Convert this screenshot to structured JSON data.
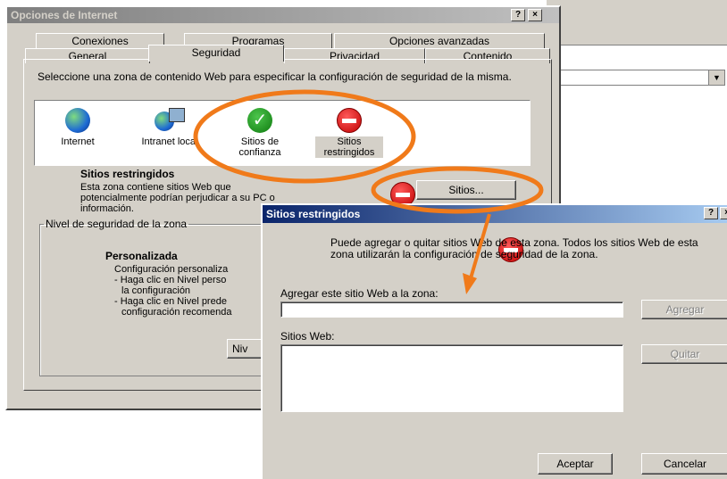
{
  "background_app": {
    "dropdown_arrow": "▼"
  },
  "main_dialog": {
    "title": "Opciones de Internet",
    "help_button": "?",
    "close_button": "×",
    "tabs_back_row": [
      "Conexiones",
      "Programas",
      "Opciones avanzadas"
    ],
    "tabs_front_row": [
      "General",
      "Seguridad",
      "Privacidad",
      "Contenido"
    ],
    "selected_tab": "Seguridad",
    "instruction": "Seleccione una zona de contenido Web para especificar la configuración de seguridad de la misma.",
    "zones": [
      {
        "label": "Internet",
        "icon": "globe-icon"
      },
      {
        "label": "Intranet local",
        "icon": "intranet-icon"
      },
      {
        "label": "Sitios de confianza",
        "icon": "trusted-sites-icon"
      },
      {
        "label": "Sitios restringidos",
        "icon": "restricted-sites-icon",
        "selected": true
      }
    ],
    "selected_zone": {
      "title": "Sitios restringidos",
      "description": "Esta zona contiene sitios Web que potencialmente podrían perjudicar a su PC o información.",
      "sites_button": "Sitios..."
    },
    "security_level": {
      "legend": "Nivel de seguridad de la zona",
      "heading": "Personalizada",
      "line1": "Configuración personaliza",
      "line2": "- Haga clic en Nivel perso",
      "line3": "la configuración",
      "line4": "- Haga clic en Nivel prede",
      "line5": "configuración recomenda",
      "level_button": "Niv"
    }
  },
  "sites_dialog": {
    "title": "Sitios restringidos",
    "help_button": "?",
    "close_button": "×",
    "message": "Puede agregar o quitar sitios Web de esta zona.  Todos los sitios Web de esta zona utilizarán la configuración de seguridad de la zona.",
    "add_label": "Agregar este sitio Web a la zona:",
    "add_input_value": "",
    "add_button": "Agregar",
    "websites_label": "Sitios Web:",
    "websites": [],
    "remove_button": "Quitar",
    "ok_button": "Aceptar",
    "cancel_button": "Cancelar"
  },
  "colors": {
    "annotation_orange": "#f07a1a",
    "dialog_face": "#d4d0c8",
    "title_active": "#0a246a"
  }
}
